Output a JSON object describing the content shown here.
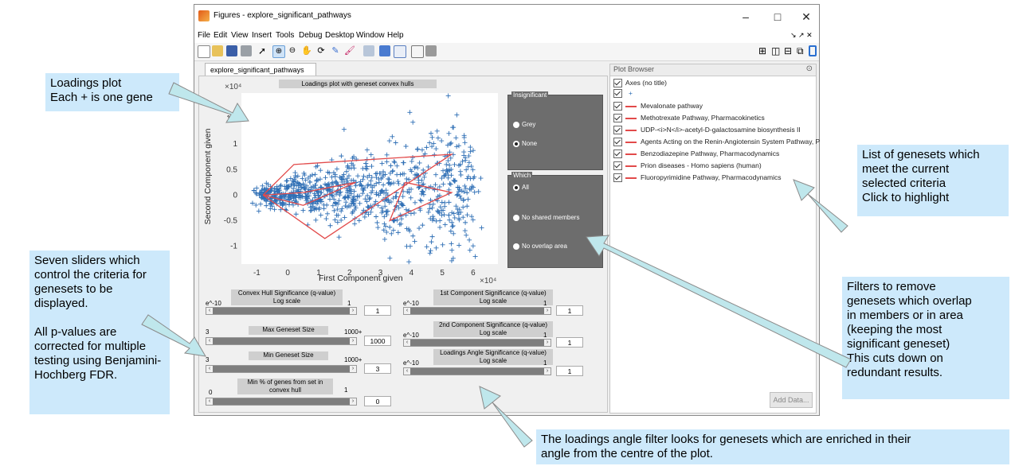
{
  "window": {
    "title": "Figures - explore_significant_pathways",
    "minimize_glyph": "–",
    "maximize_glyph": "□",
    "close_glyph": "✕"
  },
  "menu": [
    "File",
    "Edit",
    "View",
    "Insert",
    "Tools",
    "Debug",
    "Desktop",
    "Window",
    "Help"
  ],
  "tab": {
    "label": "explore_significant_pathways",
    "close_glyph": "✖"
  },
  "plot": {
    "title": "Loadings plot with geneset convex hulls",
    "x_exponent": "×10⁴",
    "y_exponent": "×10⁴",
    "xlabel": "First Component given",
    "ylabel": "Second Component given",
    "xticks": [
      "-1",
      "0",
      "1",
      "2",
      "3",
      "4",
      "5",
      "6"
    ],
    "yticks": [
      "1.5",
      "1",
      "0.5",
      "0",
      "-0.5",
      "-1"
    ]
  },
  "chart_data": {
    "type": "scatter",
    "title": "Loadings plot with geneset convex hulls",
    "xlabel": "First Component given",
    "ylabel": "Second Component given",
    "xlim": [
      -1.5,
      6.8
    ],
    "ylim": [
      -1.35,
      2.0
    ],
    "marker": "+",
    "color": "#2f6fb5",
    "hull_color": "#e24a4a",
    "hulls": [
      {
        "points": [
          [
            -0.8,
            0
          ],
          [
            0.2,
            0.6
          ],
          [
            5.3,
            0.8
          ],
          [
            1.2,
            -0.85
          ],
          [
            -0.8,
            0
          ]
        ]
      },
      {
        "points": [
          [
            3.8,
            0.25
          ],
          [
            5.3,
            0.05
          ],
          [
            3.3,
            -0.5
          ],
          [
            3.8,
            0.25
          ]
        ]
      },
      {
        "points": [
          [
            -0.8,
            0
          ],
          [
            0.5,
            0.05
          ],
          [
            2.2,
            0.25
          ],
          [
            0.5,
            -0.2
          ],
          [
            -0.8,
            0
          ]
        ]
      }
    ]
  },
  "significant": {
    "title": "Insignificant",
    "options": [
      "Grey",
      "None"
    ],
    "selected": "None"
  },
  "which": {
    "title": "Which",
    "options": [
      "All",
      "No shared members",
      "No overlap area"
    ],
    "selected": "All"
  },
  "sliders": {
    "convex": {
      "title": "Convex Hull Significance (q-value)\nLog scale",
      "min": "e^-10",
      "max": "1",
      "value": "1"
    },
    "maxsize": {
      "title": "Max Geneset Size",
      "min": "3",
      "max": "1000+",
      "value": "1000"
    },
    "minsize": {
      "title": "Min Geneset Size",
      "min": "3",
      "max": "1000+",
      "value": "3"
    },
    "minpct": {
      "title": "Min % of genes from set in\nconvex hull",
      "min": "0",
      "max": "1",
      "value": "0"
    },
    "comp1": {
      "title": "1st Component Significance (q-value)\nLog scale",
      "min": "e^-10",
      "max": "1",
      "value": "1"
    },
    "comp2": {
      "title": "2nd Component Significance (q-value)\nLog scale",
      "min": "e^-10",
      "max": "1",
      "value": "1"
    },
    "angle": {
      "title": "Loadings Angle Significance (q-value)\nLog scale",
      "min": "e^-10",
      "max": "1",
      "value": "1"
    }
  },
  "plot_browser": {
    "title": "Plot Browser",
    "items": [
      "Axes (no title)",
      "+",
      "Mevalonate pathway",
      "Methotrexate Pathway, Pharmacokinetics",
      "UDP-<i>N</i>-acetyl-D-galactosamine biosynthesis II",
      "Agents Acting on the Renin-Angiotensin System Pathway, P",
      "Benzodiazepine Pathway, Pharmacodynamics",
      "Prion diseases - Homo sapiens (human)",
      "Fluoropyrimidine Pathway, Pharmacodynamics"
    ],
    "add_data": "Add Data..."
  },
  "callouts": {
    "loadings": "Loadings plot\nEach + is one gene",
    "sliders": "Seven sliders which\ncontrol the criteria for\ngenesets to be\ndisplayed.\n\nAll p-values are\ncorrected for multiple\ntesting using Benjamini-\nHochberg FDR.",
    "list": "List of genesets which\nmeet the current\nselected criteria\nClick to highlight",
    "filters": "Filters to remove\ngenesets which overlap\nin members or in area\n(keeping the most\nsignificant geneset)\nThis cuts down on\nredundant results.",
    "angle": "The loadings angle filter looks for genesets which are enriched in their\nangle from the centre of the plot."
  },
  "colors": {
    "callout_bg": "#cde9fb",
    "marker": "#2f6fb5",
    "hull": "#e24a4a",
    "panel": "#6d6d6d"
  }
}
